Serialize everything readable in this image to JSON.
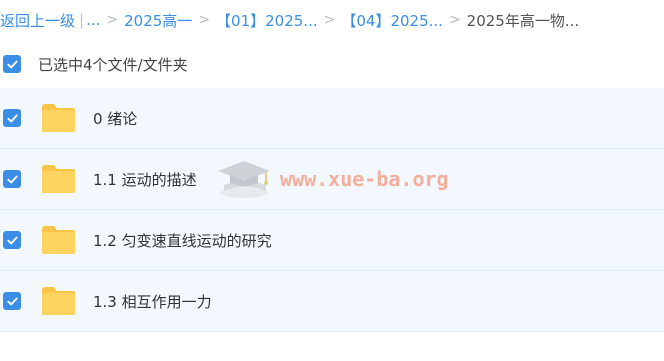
{
  "breadcrumb": {
    "back": "返回上一级",
    "bar": "|",
    "ellipsis": "...",
    "sep": ">",
    "items": [
      "2025高一",
      "【01】2025...",
      "【04】2025..."
    ],
    "current": "2025年高一物..."
  },
  "selection": {
    "label": "已选中4个文件/文件夹",
    "checked": true
  },
  "files": [
    {
      "name": "0 绪论",
      "type": "folder",
      "checked": true
    },
    {
      "name": "1.1 运动的描述",
      "type": "folder",
      "checked": true
    },
    {
      "name": "1.2 匀变速直线运动的研究",
      "type": "folder",
      "checked": true
    },
    {
      "name": "1.3 相互作用一力",
      "type": "folder",
      "checked": true
    }
  ],
  "watermark": {
    "text": "www.xue-ba.org"
  },
  "colors": {
    "accent": "#3a8ee6",
    "row_bg": "#f2f8fe",
    "folder": "#fcd35e",
    "watermark": "#f2a38a"
  },
  "icons": {
    "folder": "folder-icon",
    "checkbox": "checkbox-checked-icon",
    "watermark_logo": "graduation-cap-icon"
  }
}
